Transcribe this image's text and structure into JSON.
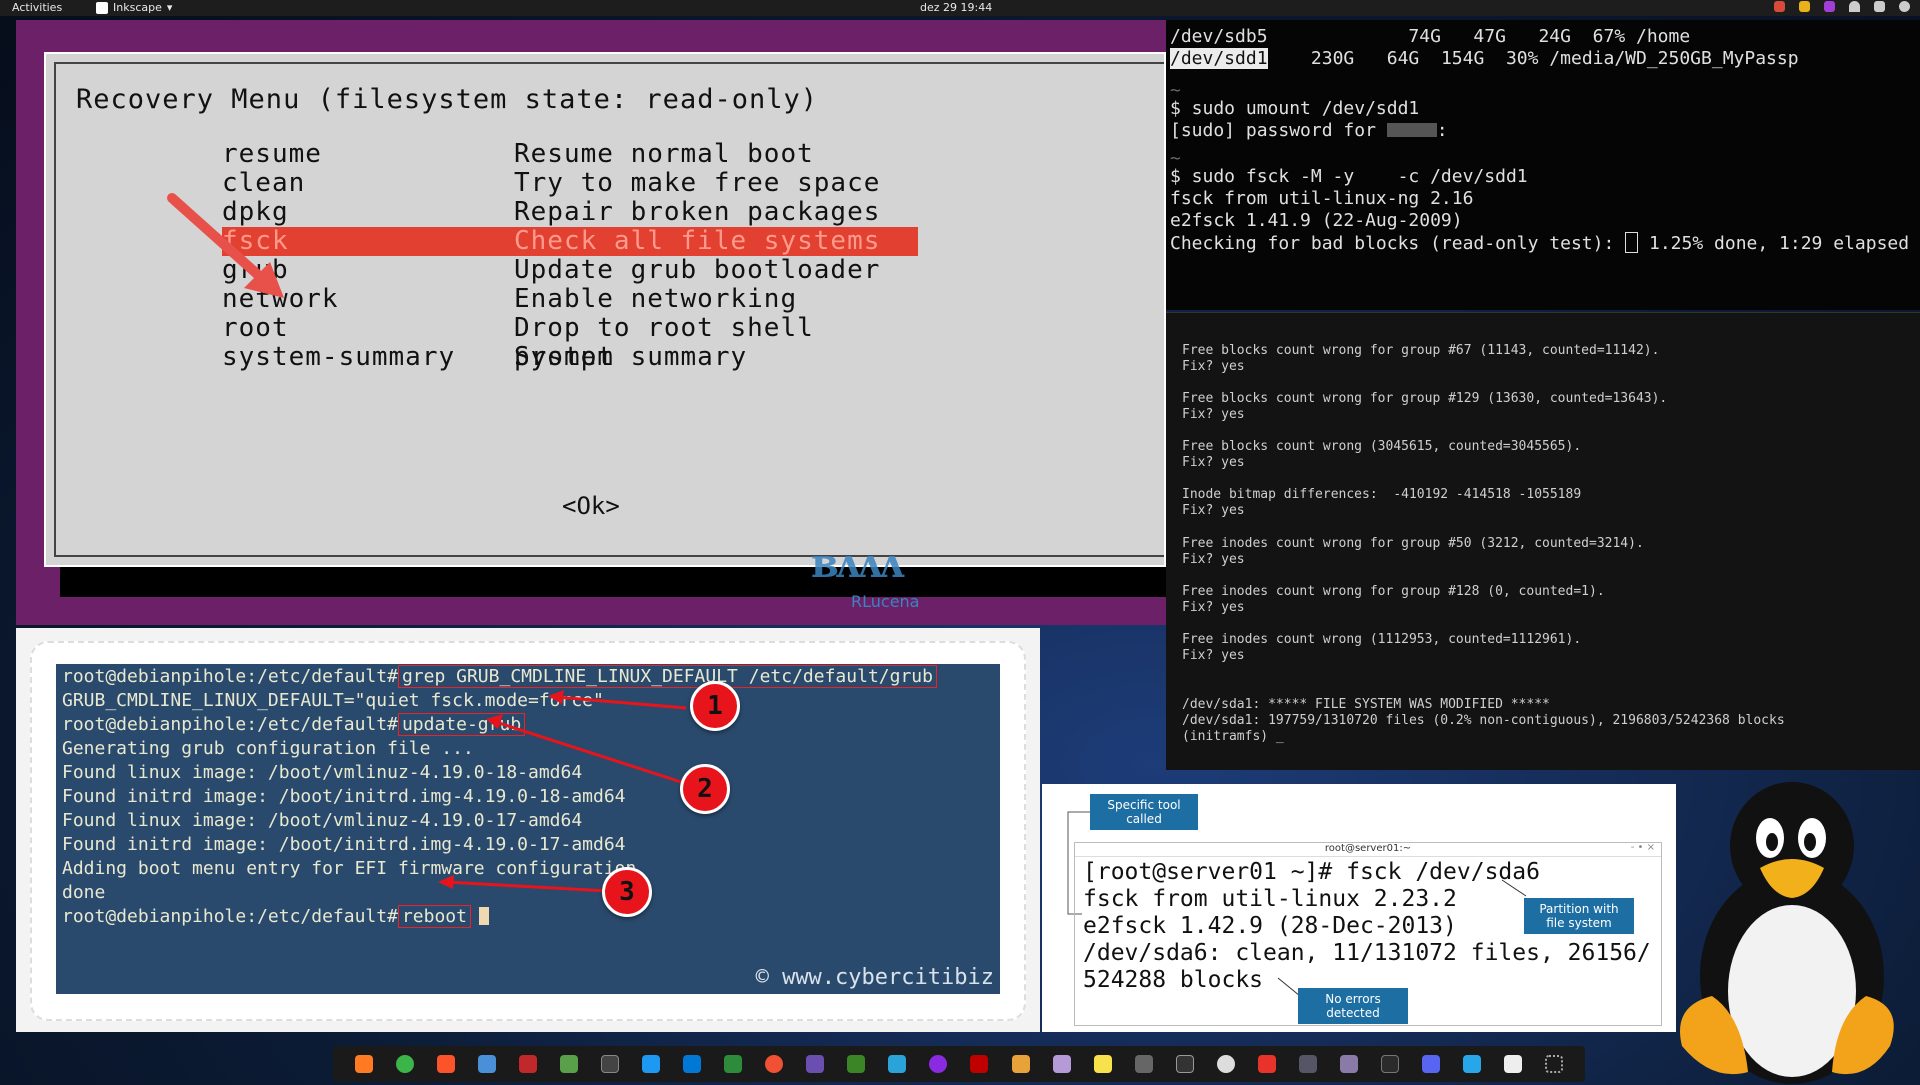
{
  "topbar": {
    "activities": "Activities",
    "app_name": "Inkscape",
    "app_menu_arrow": "▾",
    "clock": "dez 29  19:44"
  },
  "recovery_menu": {
    "title": "Recovery Menu (filesystem state: read-only)",
    "items": [
      {
        "key": "resume",
        "desc": "Resume normal boot"
      },
      {
        "key": "clean",
        "desc": "Try to make free space"
      },
      {
        "key": "dpkg",
        "desc": "Repair broken packages"
      },
      {
        "key": "fsck",
        "desc": "Check all file systems"
      },
      {
        "key": "grub",
        "desc": "Update grub bootloader"
      },
      {
        "key": "network",
        "desc": "Enable networking"
      },
      {
        "key": "root",
        "desc": "Drop to root shell prompt"
      },
      {
        "key": "system-summary",
        "desc": "System summary"
      }
    ],
    "ok_button": "<Ok>",
    "watermark_sub": "RLucena"
  },
  "terminal_top": {
    "lines": [
      "/dev/sdb5             74G   47G   24G  67% /home",
      "/dev/sdd1",
      "~",
      "$ sudo umount /dev/sdd1",
      "[sudo] password for ",
      "~",
      "$ sudo fsck -M -y    -c /dev/sdd1",
      "fsck from util-linux-ng 2.16",
      "e2fsck 1.41.9 (22-Aug-2009)",
      "Checking for bad blocks (read-only test): "
    ],
    "sdd1_stats": "    230G   64G  154G  30% /media/WD_250GB_MyPassp",
    "password_suffix": ":",
    "progress": " 1.25% done, 1:29 elapsed"
  },
  "terminal_fsck": {
    "lines": [
      "Free blocks count wrong for group #67 (11143, counted=11142).",
      "Fix? yes",
      "",
      "Free blocks count wrong for group #129 (13630, counted=13643).",
      "Fix? yes",
      "",
      "Free blocks count wrong (3045615, counted=3045565).",
      "Fix? yes",
      "",
      "Inode bitmap differences:  -410192 -414518 -1055189",
      "Fix? yes",
      "",
      "Free inodes count wrong for group #50 (3212, counted=3214).",
      "Fix? yes",
      "",
      "Free inodes count wrong for group #128 (0, counted=1).",
      "Fix? yes",
      "",
      "Free inodes count wrong (1112953, counted=1112961).",
      "Fix? yes",
      "",
      "",
      "/dev/sda1: ***** FILE SYSTEM WAS MODIFIED *****",
      "/dev/sda1: 197759/1310720 files (0.2% non-contiguous), 2196803/5242368 blocks",
      "(initramfs) _"
    ]
  },
  "cyberciti": {
    "prompt": "root@debianpihole:/etc/default#",
    "cmd1": "grep GRUB_CMDLINE_LINUX_DEFAULT /etc/default/grub",
    "out1": "GRUB_CMDLINE_LINUX_DEFAULT=\"quiet fsck.mode=force\"",
    "cmd2": "update-grub",
    "out2": [
      "Generating grub configuration file ...",
      "Found linux image: /boot/vmlinuz-4.19.0-18-amd64",
      "Found initrd image: /boot/initrd.img-4.19.0-18-amd64",
      "Found linux image: /boot/vmlinuz-4.19.0-17-amd64",
      "Found initrd image: /boot/initrd.img-4.19.0-17-amd64",
      "Adding boot menu entry for EFI firmware configuration",
      "done"
    ],
    "cmd3": "reboot",
    "badges": [
      "1",
      "2",
      "3"
    ],
    "credit": "© www.cybercitibiz"
  },
  "sda6_panel": {
    "window_title": "root@server01:~",
    "window_controls": "- • ×",
    "lines": [
      "[root@server01 ~]# fsck /dev/sda6",
      "fsck from util-linux 2.23.2",
      "e2fsck 1.42.9 (28-Dec-2013)",
      "/dev/sda6: clean, 11/131072 files, 26156/",
      "524288 blocks"
    ],
    "callout_tool": "Specific tool called",
    "callout_partition": "Partition with file system",
    "callout_errors": "No errors detected"
  },
  "colors": {
    "recovery_bg": "#6b2067",
    "menu_highlight": "#e24030",
    "badge_red": "#e8141c",
    "callout_blue": "#1d6ea3",
    "terminal_blue": "#2a4a6d"
  },
  "dock_icons": [
    "firefox-icon",
    "chrome-icon",
    "brave-icon",
    "files-icon",
    "app-icon",
    "image-icon",
    "window-icon",
    "kde-icon",
    "vscode-icon",
    "inkscape-icon",
    "git-icon",
    "app2-icon",
    "minecraft-icon",
    "editor-icon",
    "firefox-dev-icon",
    "filezilla-icon",
    "folder-icon",
    "folder2-icon",
    "notes-icon",
    "app3-icon",
    "terminal2-icon",
    "settings-icon",
    "anydesk-icon",
    "calculator-icon",
    "camera-icon",
    "terminal-icon",
    "discord-icon",
    "telegram-icon",
    "inkscape-active-icon",
    "show-apps-icon"
  ]
}
